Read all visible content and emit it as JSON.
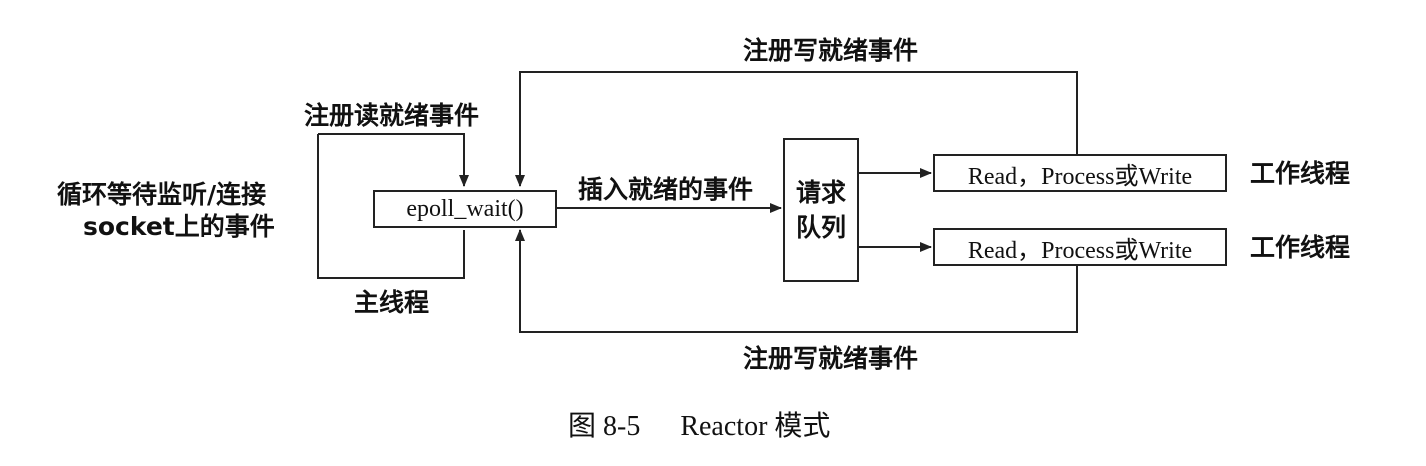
{
  "labels": {
    "register_write_top": "注册写就绪事件",
    "register_read": "注册读就绪事件",
    "wait_listen_line1": "循环等待监听/连接",
    "wait_listen_line2": "socket上的事件",
    "main_thread": "主线程",
    "insert_ready": "插入就绪的事件",
    "worker_thread_1": "工作线程",
    "worker_thread_2": "工作线程",
    "register_write_bottom": "注册写就绪事件"
  },
  "boxes": {
    "epoll_wait": "epoll_wait()",
    "request_queue_line1": "请求",
    "request_queue_line2": "队列",
    "worker_box_1": "Read，Process或Write",
    "worker_box_2": "Read，Process或Write"
  },
  "caption": {
    "figure": "图 8-5",
    "title": "Reactor 模式"
  },
  "colors": {
    "line": "#222222",
    "text": "#111111",
    "background": "#ffffff"
  }
}
